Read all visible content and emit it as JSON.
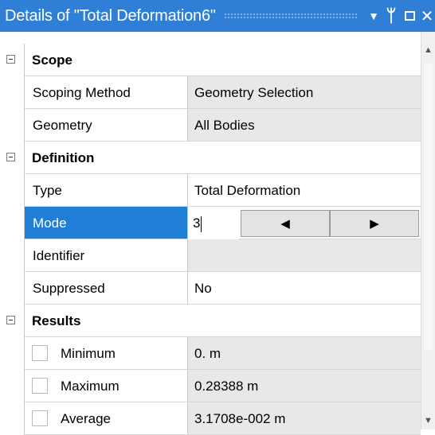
{
  "window": {
    "title": "Details of \"Total Deformation6\""
  },
  "titlebar_icons": [
    "dropdown-arrow-icon",
    "pin-icon",
    "maximize-icon",
    "close-icon"
  ],
  "scope": {
    "label": "Scope",
    "rows": [
      {
        "name": "Scoping Method",
        "value": "Geometry Selection"
      },
      {
        "name": "Geometry",
        "value": "All Bodies"
      }
    ]
  },
  "definition": {
    "label": "Definition",
    "rows": [
      {
        "name": "Type",
        "value": "Total Deformation"
      },
      {
        "name": "Mode",
        "value": "3"
      },
      {
        "name": "Identifier",
        "value": ""
      },
      {
        "name": "Suppressed",
        "value": "No"
      }
    ]
  },
  "results": {
    "label": "Results",
    "rows": [
      {
        "name": "Minimum",
        "value": "0. m"
      },
      {
        "name": "Maximum",
        "value": "0.28388 m"
      },
      {
        "name": "Average",
        "value": "3.1708e-002 m"
      }
    ]
  },
  "colors": {
    "titlebar": "#2f7fd6",
    "selection": "#1f7fd8",
    "readonly": "#e8e8e8"
  }
}
